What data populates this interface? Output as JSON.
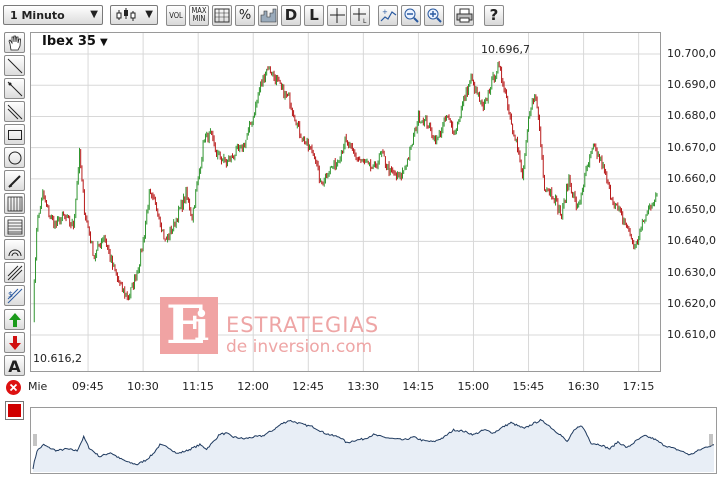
{
  "toolbar": {
    "period_label": "1 Minuto",
    "vol_label": "VOL",
    "maxmin_label": "MAX MIN",
    "percent_label": "%",
    "d_label": "D",
    "l_label": "L",
    "help_label": "?"
  },
  "sidebar": {
    "text_tool_label": "A"
  },
  "chart": {
    "ticker": "Ibex 35",
    "high_label": "10.696,7",
    "low_label": "10.616,2",
    "y_ticks": [
      "10.700,0",
      "10.690,0",
      "10.680,0",
      "10.670,0",
      "10.660,0",
      "10.650,0",
      "10.640,0",
      "10.630,0",
      "10.620,0",
      "10.610,0"
    ],
    "x_ticks": [
      "Mie",
      "09:45",
      "10:30",
      "11:15",
      "12:00",
      "12:45",
      "13:30",
      "14:15",
      "15:00",
      "15:45",
      "16:30",
      "17:15"
    ]
  },
  "watermark": {
    "line1": "ESTRATEGIAS",
    "line2": "de inversion.com"
  },
  "colors": {
    "up": "#1a8a1a",
    "down": "#b00000",
    "grid": "#d8d8d8",
    "nav_line": "#1f3a5f",
    "nav_fill": "#e8eef6",
    "watermark": "#f0a3a3"
  },
  "chart_data": {
    "type": "candlestick",
    "ylim": [
      10605,
      10710
    ],
    "x_ticks": [
      "Mie",
      "09:45",
      "10:30",
      "11:15",
      "12:00",
      "12:45",
      "13:30",
      "14:15",
      "15:00",
      "15:45",
      "16:30",
      "17:15"
    ],
    "anchors": [
      [
        "09:00",
        10616
      ],
      [
        "09:03",
        10645
      ],
      [
        "09:08",
        10655
      ],
      [
        "09:12",
        10650
      ],
      [
        "09:18",
        10645
      ],
      [
        "09:25",
        10648
      ],
      [
        "09:33",
        10645
      ],
      [
        "09:38",
        10668
      ],
      [
        "09:42",
        10650
      ],
      [
        "09:50",
        10635
      ],
      [
        "09:58",
        10642
      ],
      [
        "10:05",
        10632
      ],
      [
        "10:12",
        10625
      ],
      [
        "10:18",
        10622
      ],
      [
        "10:25",
        10630
      ],
      [
        "10:30",
        10640
      ],
      [
        "10:35",
        10655
      ],
      [
        "10:42",
        10650
      ],
      [
        "10:48",
        10640
      ],
      [
        "10:55",
        10645
      ],
      [
        "11:00",
        10650
      ],
      [
        "11:05",
        10655
      ],
      [
        "11:10",
        10648
      ],
      [
        "11:15",
        10660
      ],
      [
        "11:20",
        10673
      ],
      [
        "11:25",
        10674
      ],
      [
        "11:30",
        10668
      ],
      [
        "11:38",
        10665
      ],
      [
        "11:45",
        10668
      ],
      [
        "11:52",
        10670
      ],
      [
        "12:00",
        10680
      ],
      [
        "12:06",
        10690
      ],
      [
        "12:12",
        10696
      ],
      [
        "12:18",
        10692
      ],
      [
        "12:24",
        10688
      ],
      [
        "12:30",
        10685
      ],
      [
        "12:38",
        10675
      ],
      [
        "12:45",
        10670
      ],
      [
        "12:50",
        10668
      ],
      [
        "12:55",
        10658
      ],
      [
        "13:00",
        10662
      ],
      [
        "13:08",
        10665
      ],
      [
        "13:15",
        10672
      ],
      [
        "13:22",
        10668
      ],
      [
        "13:30",
        10665
      ],
      [
        "13:38",
        10663
      ],
      [
        "13:45",
        10668
      ],
      [
        "13:52",
        10662
      ],
      [
        "14:00",
        10660
      ],
      [
        "14:08",
        10668
      ],
      [
        "14:15",
        10680
      ],
      [
        "14:22",
        10678
      ],
      [
        "14:30",
        10672
      ],
      [
        "14:38",
        10680
      ],
      [
        "14:45",
        10675
      ],
      [
        "14:52",
        10685
      ],
      [
        "14:58",
        10692
      ],
      [
        "15:02",
        10688
      ],
      [
        "15:08",
        10682
      ],
      [
        "15:14",
        10690
      ],
      [
        "15:20",
        10696
      ],
      [
        "15:25",
        10690
      ],
      [
        "15:30",
        10680
      ],
      [
        "15:35",
        10672
      ],
      [
        "15:40",
        10660
      ],
      [
        "15:45",
        10678
      ],
      [
        "15:50",
        10688
      ],
      [
        "15:53",
        10680
      ],
      [
        "15:58",
        10658
      ],
      [
        "16:05",
        10655
      ],
      [
        "16:12",
        10648
      ],
      [
        "16:18",
        10660
      ],
      [
        "16:25",
        10650
      ],
      [
        "16:32",
        10662
      ],
      [
        "16:38",
        10670
      ],
      [
        "16:45",
        10665
      ],
      [
        "16:52",
        10655
      ],
      [
        "16:58",
        10650
      ],
      [
        "17:05",
        10645
      ],
      [
        "17:12",
        10638
      ],
      [
        "17:18",
        10645
      ],
      [
        "17:25",
        10652
      ],
      [
        "17:30",
        10655
      ]
    ]
  }
}
